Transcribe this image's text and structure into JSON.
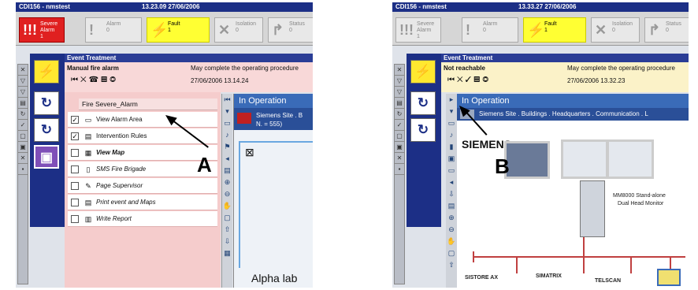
{
  "screen_a": {
    "app_title": "CDI156 - nmstest",
    "clock": "13.23.09  27/06/2006",
    "alarm_tiles": [
      {
        "label": "Severe Alarm",
        "count": "1",
        "icon": "siren-icon"
      },
      {
        "label": "Alarm",
        "count": "0",
        "icon": "exclamation-icon"
      },
      {
        "label": "Fault",
        "count": "1",
        "icon": "lightning-icon"
      },
      {
        "label": "Isolation",
        "count": "0",
        "icon": "cross-icon"
      },
      {
        "label": "Status",
        "count": "0",
        "icon": "arrow-icon"
      }
    ],
    "event_treatment": "Event Treatment",
    "event_title": "Manual fire alarm",
    "procedure_text": "May complete the operating procedure",
    "timestamp": "27/06/2006  13.14.24",
    "steps_title": "Fire Severe_Alarm",
    "steps": [
      {
        "label": "View Alarm Area",
        "checked": true
      },
      {
        "label": "Intervention Rules",
        "checked": true
      },
      {
        "label": "View Map",
        "checked": false
      },
      {
        "label": "SMS Fire Brigade",
        "checked": false
      },
      {
        "label": "Page  Supervisor",
        "checked": false
      },
      {
        "label": "Print event and Maps",
        "checked": false
      },
      {
        "label": "Write Report",
        "checked": false
      }
    ],
    "in_operation": "In Operation",
    "site_line1": "Siemens Site . B",
    "site_line2": "N. = 555)",
    "alpha_label": "Alpha lab",
    "annotation": "A"
  },
  "screen_b": {
    "app_title": "CDI156 - nmstest",
    "clock": "13.33.27  27/06/2006",
    "alarm_tiles": [
      {
        "label": "Severe Alarm",
        "count": "1"
      },
      {
        "label": "Alarm",
        "count": "0"
      },
      {
        "label": "Fault",
        "count": "1"
      },
      {
        "label": "Isolation",
        "count": "0"
      },
      {
        "label": "Status",
        "count": "0"
      }
    ],
    "event_treatment": "Event Treatment",
    "event_title": "Not reachable",
    "procedure_text": "May complete the operating procedure",
    "timestamp": "27/06/2006  13.32.23",
    "in_operation": "In Operation",
    "breadcrumb": "Siemens Site . Buildings . Headquarters . Communication . L",
    "brand": "SIEMENS",
    "mm_caption_1": "MM8000 Stand-alone",
    "mm_caption_2": "Dual Head Monitor",
    "devices": [
      "SISTORE AX",
      "SIMATRIX",
      "TELSCAN"
    ],
    "annotation": "B"
  }
}
